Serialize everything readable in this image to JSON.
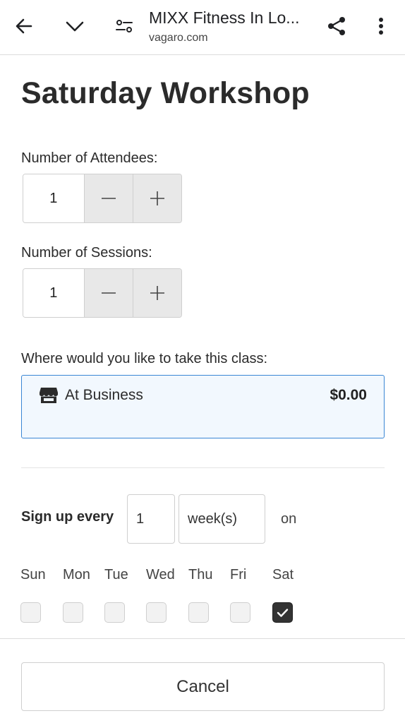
{
  "browser": {
    "title": "MIXX Fitness In Lo...",
    "url": "vagaro.com",
    "icons": {
      "back": "arrow-left-icon",
      "collapse": "chevron-down-icon",
      "settings": "tune-icon",
      "share": "share-icon",
      "more": "more-vert-icon"
    }
  },
  "page": {
    "title": "Saturday Workshop"
  },
  "attendees": {
    "label": "Number of Attendees:",
    "value": "1",
    "decrement": "−",
    "increment": "+"
  },
  "sessions": {
    "label": "Number of Sessions:",
    "value": "1",
    "decrement": "−",
    "increment": "+"
  },
  "location": {
    "question": "Where would you like to take this class:",
    "option_label": "At Business",
    "price": "$0.00",
    "icon": "store-icon",
    "accent_color": "#3a86d4",
    "background_color": "#f2f8fe"
  },
  "recurrence": {
    "signup_label": "Sign up every",
    "every_value": "1",
    "unit_value": "week(s)",
    "on_label": "on",
    "days": [
      {
        "label": "Sun",
        "checked": false
      },
      {
        "label": "Mon",
        "checked": false
      },
      {
        "label": "Tue",
        "checked": false
      },
      {
        "label": "Wed",
        "checked": false
      },
      {
        "label": "Thu",
        "checked": false
      },
      {
        "label": "Fri",
        "checked": false
      },
      {
        "label": "Sat",
        "checked": true
      }
    ]
  },
  "footer": {
    "cancel_label": "Cancel"
  }
}
